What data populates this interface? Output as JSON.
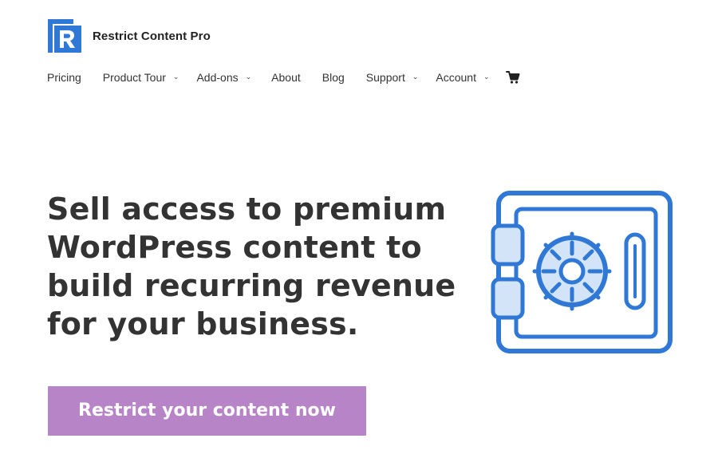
{
  "brand": {
    "name": "Restrict Content Pro",
    "accent": "#2f78d6",
    "logo_icon": "rcp-logo-icon"
  },
  "nav": {
    "items": [
      {
        "label": "Pricing",
        "dropdown": false
      },
      {
        "label": "Product Tour",
        "dropdown": true
      },
      {
        "label": "Add-ons",
        "dropdown": true
      },
      {
        "label": "About",
        "dropdown": false
      },
      {
        "label": "Blog",
        "dropdown": false
      },
      {
        "label": "Support",
        "dropdown": true
      },
      {
        "label": "Account",
        "dropdown": true
      }
    ],
    "chevron": "⌄",
    "cart_icon": "cart-icon"
  },
  "hero": {
    "title_lines": [
      "Sell access to premium",
      "WordPress content to",
      "build recurring revenue",
      "for your business."
    ],
    "illustration_icon": "safe-icon"
  },
  "cta": {
    "label": "Restrict your content now",
    "color": "#b784c7"
  }
}
